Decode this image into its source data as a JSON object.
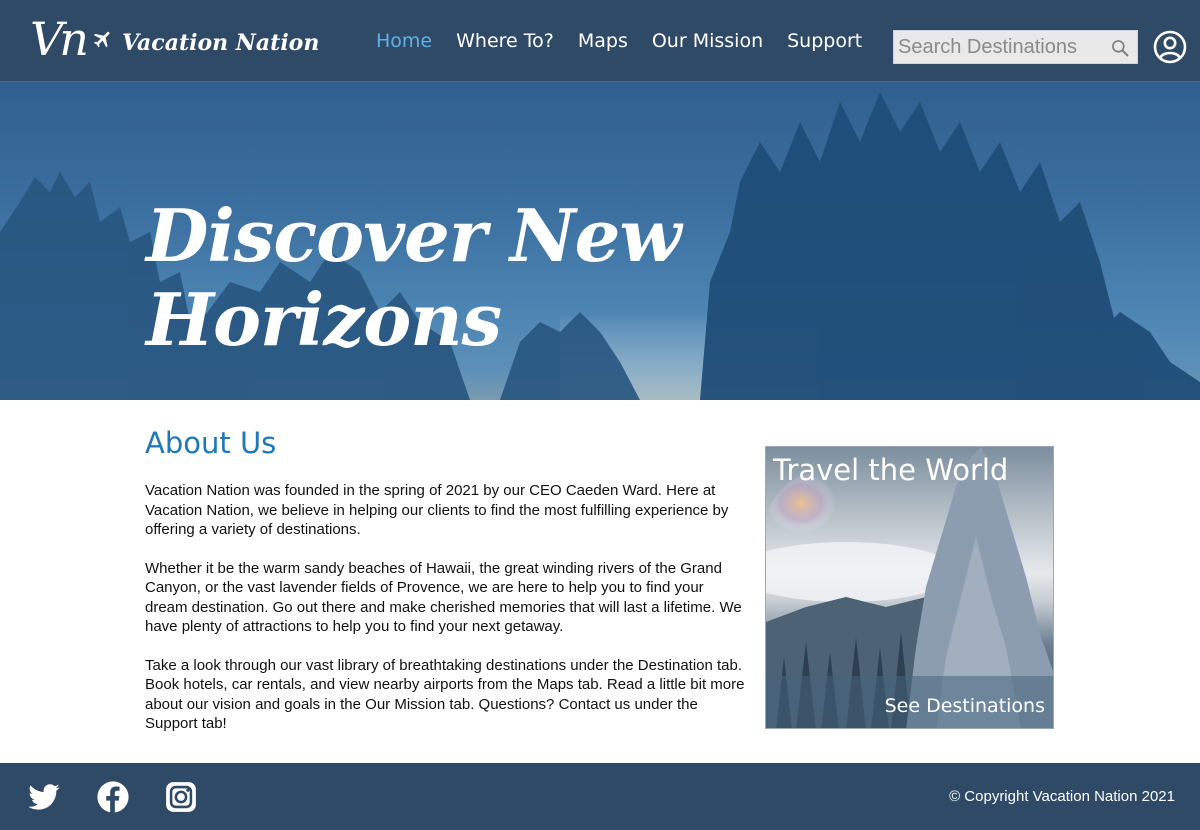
{
  "colors": {
    "nav_bg": "#2f4a66",
    "accent": "#5fb1e6",
    "heading_blue": "#1f78b8",
    "footer_bg": "#2f4a66"
  },
  "brand": {
    "monogram": "Vn",
    "name": "Vacation Nation",
    "icon": "airplane-icon"
  },
  "nav": {
    "items": [
      {
        "label": "Home",
        "active": true
      },
      {
        "label": "Where To?",
        "active": false
      },
      {
        "label": "Maps",
        "active": false
      },
      {
        "label": "Our Mission",
        "active": false
      },
      {
        "label": "Support",
        "active": false
      }
    ],
    "search": {
      "placeholder": "Search Destinations",
      "value": "",
      "icon": "search-icon"
    },
    "account_icon": "user-account-icon"
  },
  "hero": {
    "title_line1": "Discover New",
    "title_line2": "Horizons"
  },
  "about": {
    "heading": "About Us",
    "paragraphs": [
      "Vacation Nation was founded in the spring of 2021 by our CEO Caeden Ward. Here at Vacation Nation, we believe in helping our clients to find the most fulfilling experience by offering a variety of destinations.",
      "Whether it be the warm sandy beaches of Hawaii, the great winding rivers of the Grand Canyon, or the vast lavender fields of Provence, we are here to help you to find your dream destination. Go out there and make cherished memories that will last a lifetime. We have plenty of attractions to help you to find your next getaway.",
      "Take a look through our vast library of breathtaking destinations under the Destination tab. Book hotels, car rentals, and view nearby airports from the Maps tab. Read a little bit more about our vision and goals in the Our Mission tab. Questions? Contact us under the Support tab!"
    ]
  },
  "promo": {
    "title": "Travel the World",
    "cta": "See Destinations"
  },
  "footer": {
    "social": [
      "twitter-icon",
      "facebook-icon",
      "instagram-icon"
    ],
    "copyright": "© Copyright Vacation Nation 2021"
  }
}
